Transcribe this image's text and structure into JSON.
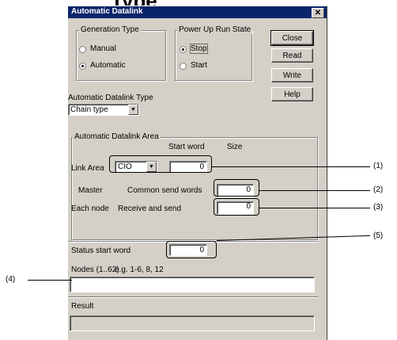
{
  "page_heading": "Type",
  "window": {
    "title": "Automatic Datalink",
    "close_glyph": "✕"
  },
  "generation_type": {
    "label": "Generation Type",
    "options": [
      "Manual",
      "Automatic"
    ],
    "selected": "Automatic"
  },
  "power_up_run_state": {
    "label": "Power Up Run State",
    "options": [
      "Stop",
      "Start"
    ],
    "selected": "Stop"
  },
  "buttons": {
    "close": "Close",
    "read": "Read",
    "write": "Write",
    "help": "Help"
  },
  "datalink_type": {
    "label": "Automatic Datalink Type",
    "value": "Chain type"
  },
  "area": {
    "label": "Automatic Datalink Area",
    "col_start_word": "Start word",
    "col_size": "Size",
    "link_area_label": "Link Area",
    "link_area_value": "CIO",
    "link_start_word": "0",
    "master_label": "Master",
    "common_send_label": "Common send words",
    "common_send_value": "0",
    "each_node_label": "Each node",
    "recv_send_label": "Receive and send",
    "recv_send_value": "0"
  },
  "status": {
    "label": "Status start word",
    "value": "0"
  },
  "nodes": {
    "label": "Nodes (1..62)",
    "example": "e.g. 1-6, 8, 12",
    "value": ""
  },
  "result": {
    "label": "Result",
    "value": ""
  },
  "callouts": [
    "(1)",
    "(2)",
    "(3)",
    "(5)",
    "(4)"
  ]
}
